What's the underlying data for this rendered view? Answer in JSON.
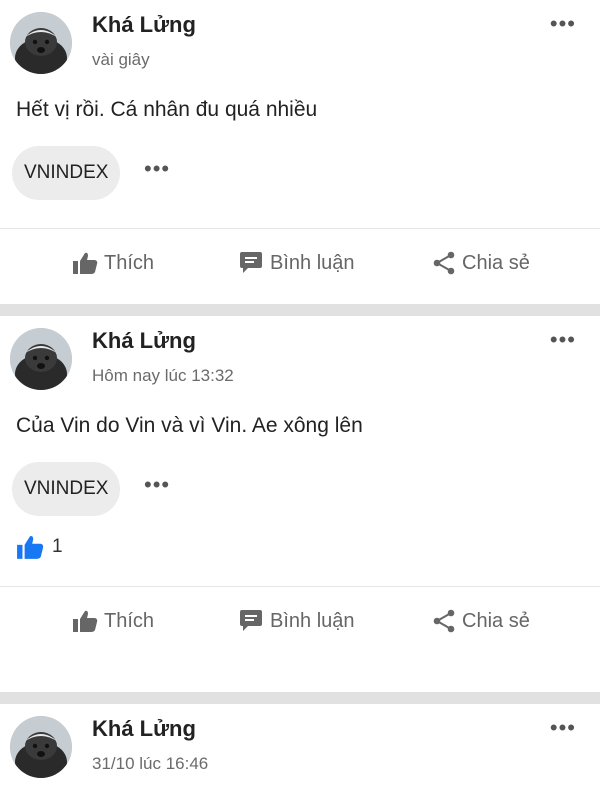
{
  "posts": [
    {
      "author": "Khá Lửng",
      "time": "vài giây",
      "text": "Hết vị rồi. Cá nhân đu quá nhiều",
      "tag": "VNINDEX",
      "more": "•••",
      "tag_more": "•••"
    },
    {
      "author": "Khá Lửng",
      "time": "Hôm nay lúc 13:32",
      "text": "Của Vin do Vin và vì Vin. Ae xông lên",
      "tag": "VNINDEX",
      "more": "•••",
      "tag_more": "•••",
      "like_count": "1"
    },
    {
      "author": "Khá Lửng",
      "time": "31/10 lúc 16:46",
      "more": "•••"
    }
  ],
  "actions": {
    "like": "Thích",
    "comment": "Bình luận",
    "share": "Chia sẻ"
  },
  "icons": {
    "like": "thumbs-up-icon",
    "comment": "comment-bubble-icon",
    "share": "share-icon",
    "more": "more-dots-icon"
  },
  "colors": {
    "like_blue": "#1877f2",
    "action_gray": "#666666",
    "separator": "#e1e1e1"
  }
}
